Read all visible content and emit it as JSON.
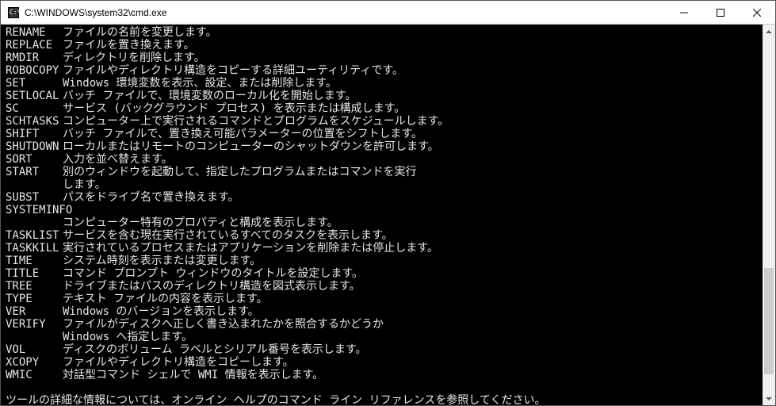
{
  "window": {
    "title": "C:\\WINDOWS\\system32\\cmd.exe"
  },
  "commands": [
    {
      "name": "RENAME",
      "desc": "ファイルの名前を変更します。"
    },
    {
      "name": "REPLACE",
      "desc": "ファイルを置き換えます。"
    },
    {
      "name": "RMDIR",
      "desc": "ディレクトリを削除します。"
    },
    {
      "name": "ROBOCOPY",
      "desc": "ファイルやディレクトリ構造をコピーする詳細ユーティリティです。"
    },
    {
      "name": "SET",
      "desc": "Windows 環境変数を表示、設定、または削除します。"
    },
    {
      "name": "SETLOCAL",
      "desc": "バッチ ファイルで、環境変数のローカル化を開始します。"
    },
    {
      "name": "SC",
      "desc": "サービス (バックグラウンド プロセス) を表示または構成します。"
    },
    {
      "name": "SCHTASKS",
      "desc": "コンピューター上で実行されるコマンドとプログラムをスケジュールします。"
    },
    {
      "name": "SHIFT",
      "desc": "バッチ ファイルで、置き換え可能パラメーターの位置をシフトします。"
    },
    {
      "name": "SHUTDOWN",
      "desc": "ローカルまたはリモートのコンピューターのシャットダウンを許可します。"
    },
    {
      "name": "SORT",
      "desc": "入力を並べ替えます。"
    },
    {
      "name": "START",
      "desc": "別のウィンドウを起動して、指定したプログラムまたはコマンドを実行"
    },
    {
      "name": "",
      "desc": "します。"
    },
    {
      "name": "SUBST",
      "desc": "パスをドライブ名で置き換えます。"
    },
    {
      "name": "SYSTEMINFO",
      "desc": ""
    },
    {
      "name": "",
      "desc": "コンピューター特有のプロパティと構成を表示します。"
    },
    {
      "name": "TASKLIST",
      "desc": "サービスを含む現在実行されているすべてのタスクを表示します。"
    },
    {
      "name": "TASKKILL",
      "desc": "実行されているプロセスまたはアプリケーションを削除または停止します。"
    },
    {
      "name": "TIME",
      "desc": "システム時刻を表示または変更します。"
    },
    {
      "name": "TITLE",
      "desc": "コマンド プロンプト ウィンドウのタイトルを設定します。"
    },
    {
      "name": "TREE",
      "desc": "ドライブまたはパスのディレクトリ構造を図式表示します。"
    },
    {
      "name": "TYPE",
      "desc": "テキスト ファイルの内容を表示します。"
    },
    {
      "name": "VER",
      "desc": "Windows のバージョンを表示します。"
    },
    {
      "name": "VERIFY",
      "desc": "ファイルがディスクへ正しく書き込まれたかを照合するかどうか"
    },
    {
      "name": "",
      "desc": "Windows へ指定します。"
    },
    {
      "name": "VOL",
      "desc": "ディスクのボリューム ラベルとシリアル番号を表示します。"
    },
    {
      "name": "XCOPY",
      "desc": "ファイルやディレクトリ構造をコピーします。"
    },
    {
      "name": "WMIC",
      "desc": "対話型コマンド シェルで WMI 情報を表示します。"
    }
  ],
  "footer": "ツールの詳細な情報については、オンライン ヘルプのコマンド ライン リファレンスを参照してください。"
}
